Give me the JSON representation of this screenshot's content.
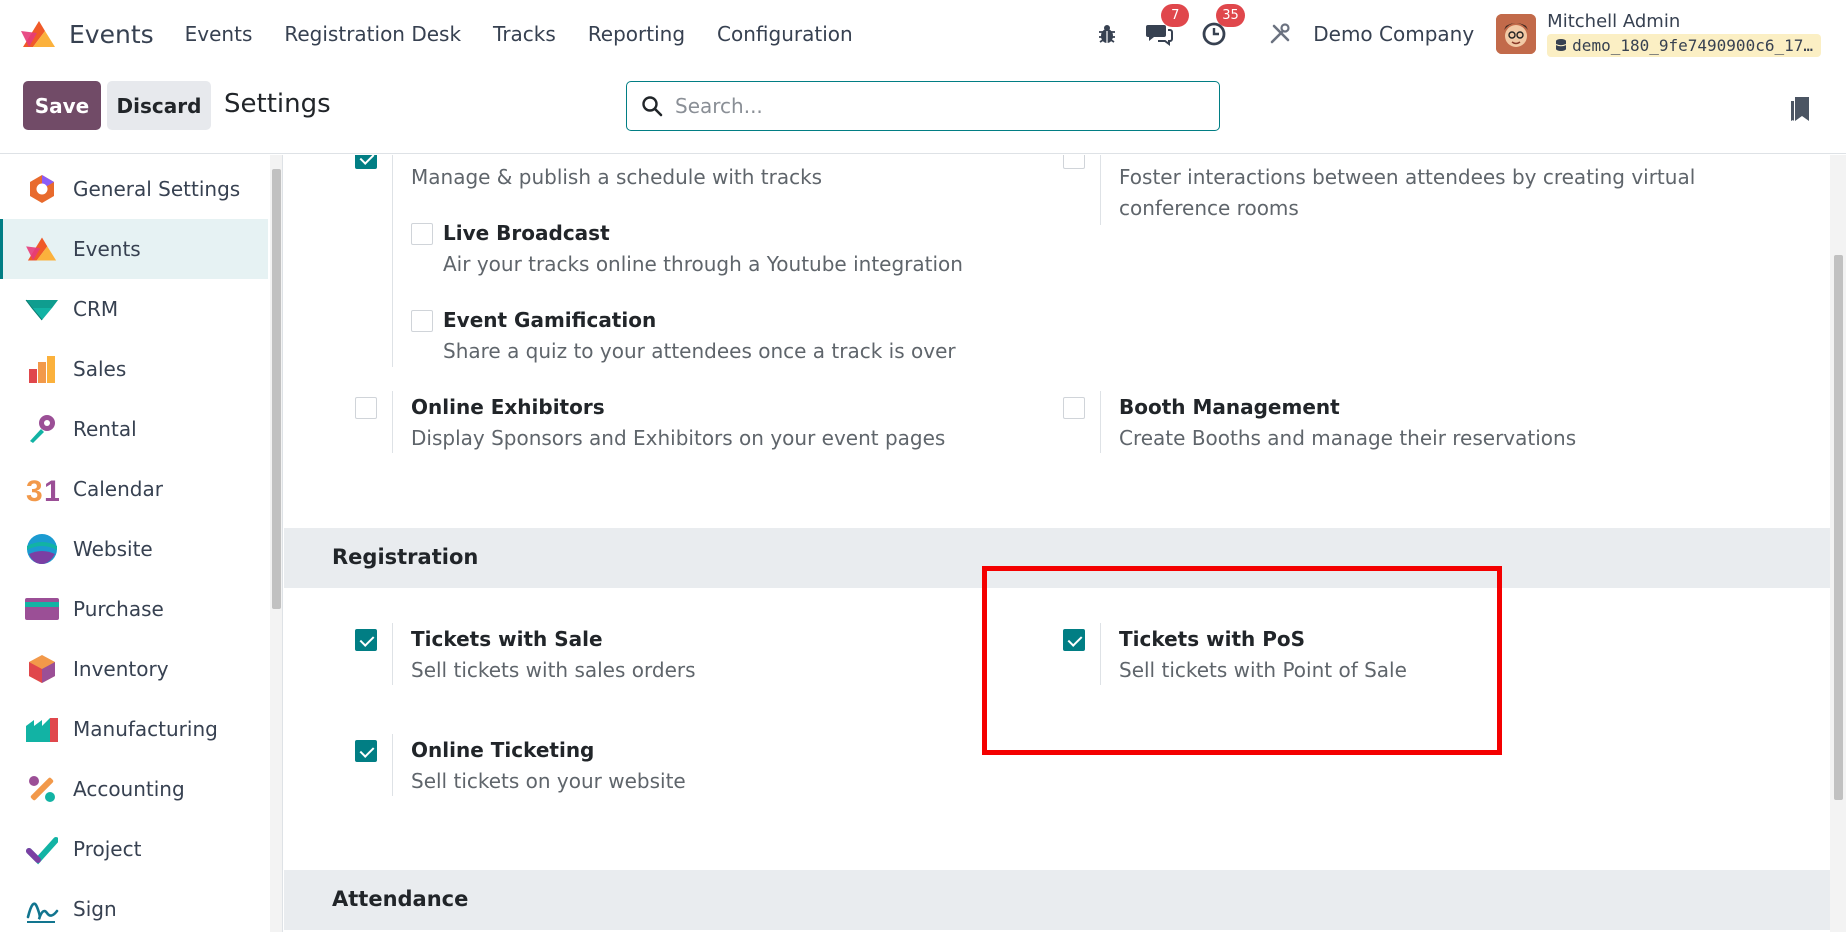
{
  "navbar": {
    "app_name": "Events",
    "menu": [
      "Events",
      "Registration Desk",
      "Tracks",
      "Reporting",
      "Configuration"
    ],
    "messages_badge": "7",
    "activities_badge": "35",
    "company": "Demo Company",
    "user_name": "Mitchell Admin",
    "database": "demo_180_9fe7490900c6_17…"
  },
  "control": {
    "save_label": "Save",
    "discard_label": "Discard",
    "title": "Settings",
    "search_placeholder": "Search..."
  },
  "sidebar": {
    "items": [
      {
        "label": "General Settings",
        "icon": "general-settings-icon"
      },
      {
        "label": "Events",
        "icon": "events-icon",
        "active": true
      },
      {
        "label": "CRM",
        "icon": "crm-icon"
      },
      {
        "label": "Sales",
        "icon": "sales-icon"
      },
      {
        "label": "Rental",
        "icon": "rental-icon"
      },
      {
        "label": "Calendar",
        "icon": "calendar-icon"
      },
      {
        "label": "Website",
        "icon": "website-icon"
      },
      {
        "label": "Purchase",
        "icon": "purchase-icon"
      },
      {
        "label": "Inventory",
        "icon": "inventory-icon"
      },
      {
        "label": "Manufacturing",
        "icon": "manufacturing-icon"
      },
      {
        "label": "Accounting",
        "icon": "accounting-icon"
      },
      {
        "label": "Project",
        "icon": "project-icon"
      },
      {
        "label": "Sign",
        "icon": "sign-icon"
      }
    ]
  },
  "settings": {
    "tracks_desc": "Manage & publish a schedule with tracks",
    "community_desc_1": "Foster interactions between attendees by creating virtual",
    "community_desc_2": "conference rooms",
    "live_broadcast": {
      "title": "Live Broadcast",
      "desc": "Air your tracks online through a Youtube integration",
      "checked": false
    },
    "gamification": {
      "title": "Event Gamification",
      "desc": "Share a quiz to your attendees once a track is over",
      "checked": false
    },
    "exhibitors": {
      "title": "Online Exhibitors",
      "desc": "Display Sponsors and Exhibitors on your event pages",
      "checked": false
    },
    "booth": {
      "title": "Booth Management",
      "desc": "Create Booths and manage their reservations",
      "checked": false
    },
    "registration_section": "Registration",
    "tickets_sale": {
      "title": "Tickets with Sale",
      "desc": "Sell tickets with sales orders",
      "checked": true
    },
    "tickets_pos": {
      "title": "Tickets with PoS",
      "desc": "Sell tickets with Point of Sale",
      "checked": true
    },
    "online_ticketing": {
      "title": "Online Ticketing",
      "desc": "Sell tickets on your website",
      "checked": true
    },
    "attendance_section": "Attendance"
  },
  "colors": {
    "primary": "#714b67",
    "accent": "#017e84",
    "highlight": "#f40000",
    "badge": "#e0474c"
  }
}
